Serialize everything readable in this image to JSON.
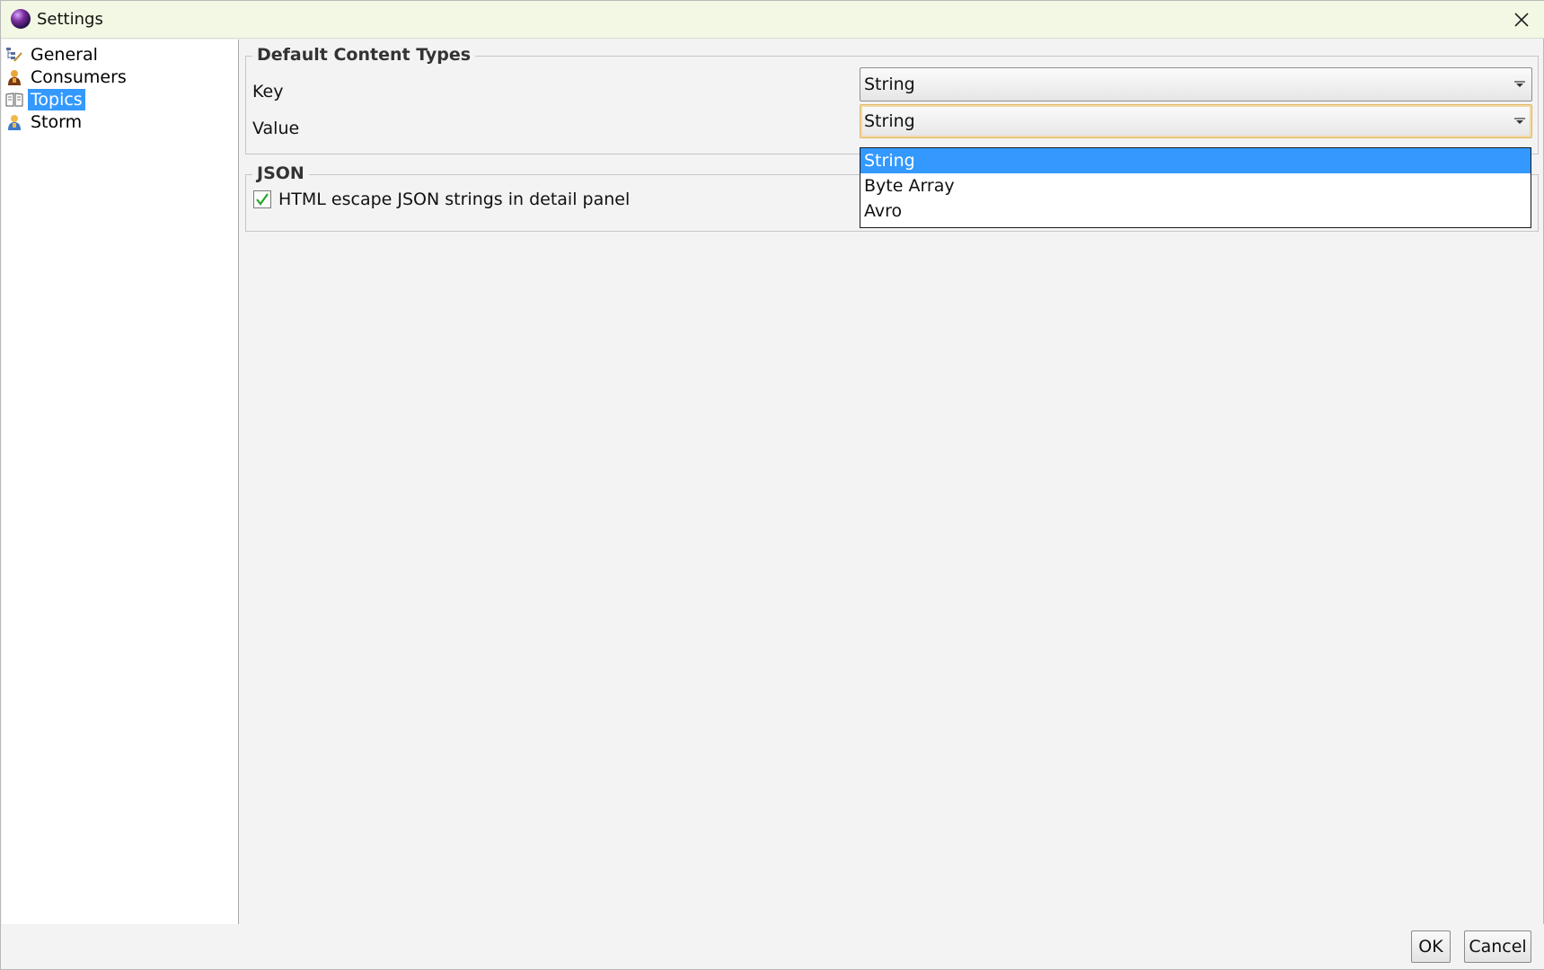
{
  "window": {
    "title": "Settings",
    "close_icon": "close-icon"
  },
  "sidebar": {
    "items": [
      {
        "label": "General",
        "icon": "general-tree-icon",
        "selected": false
      },
      {
        "label": "Consumers",
        "icon": "consumers-person-icon",
        "selected": false
      },
      {
        "label": "Topics",
        "icon": "topics-book-icon",
        "selected": true
      },
      {
        "label": "Storm",
        "icon": "storm-person-icon",
        "selected": false
      }
    ]
  },
  "content_types": {
    "legend": "Default Content Types",
    "key_label": "Key",
    "key_value": "String",
    "value_label": "Value",
    "value_value": "String",
    "dropdown_options": [
      "String",
      "Byte Array",
      "Avro"
    ],
    "dropdown_selected": "String"
  },
  "json": {
    "legend": "JSON",
    "checkbox_label": "HTML escape JSON strings in detail panel",
    "checkbox_checked": true
  },
  "buttons": {
    "ok_label": "OK",
    "cancel_label": "Cancel"
  },
  "colors": {
    "title_bar": "#f2f8e3",
    "selection": "#3399ff",
    "focus_border": "#e0b96a",
    "check_mark": "#2aa52a"
  }
}
